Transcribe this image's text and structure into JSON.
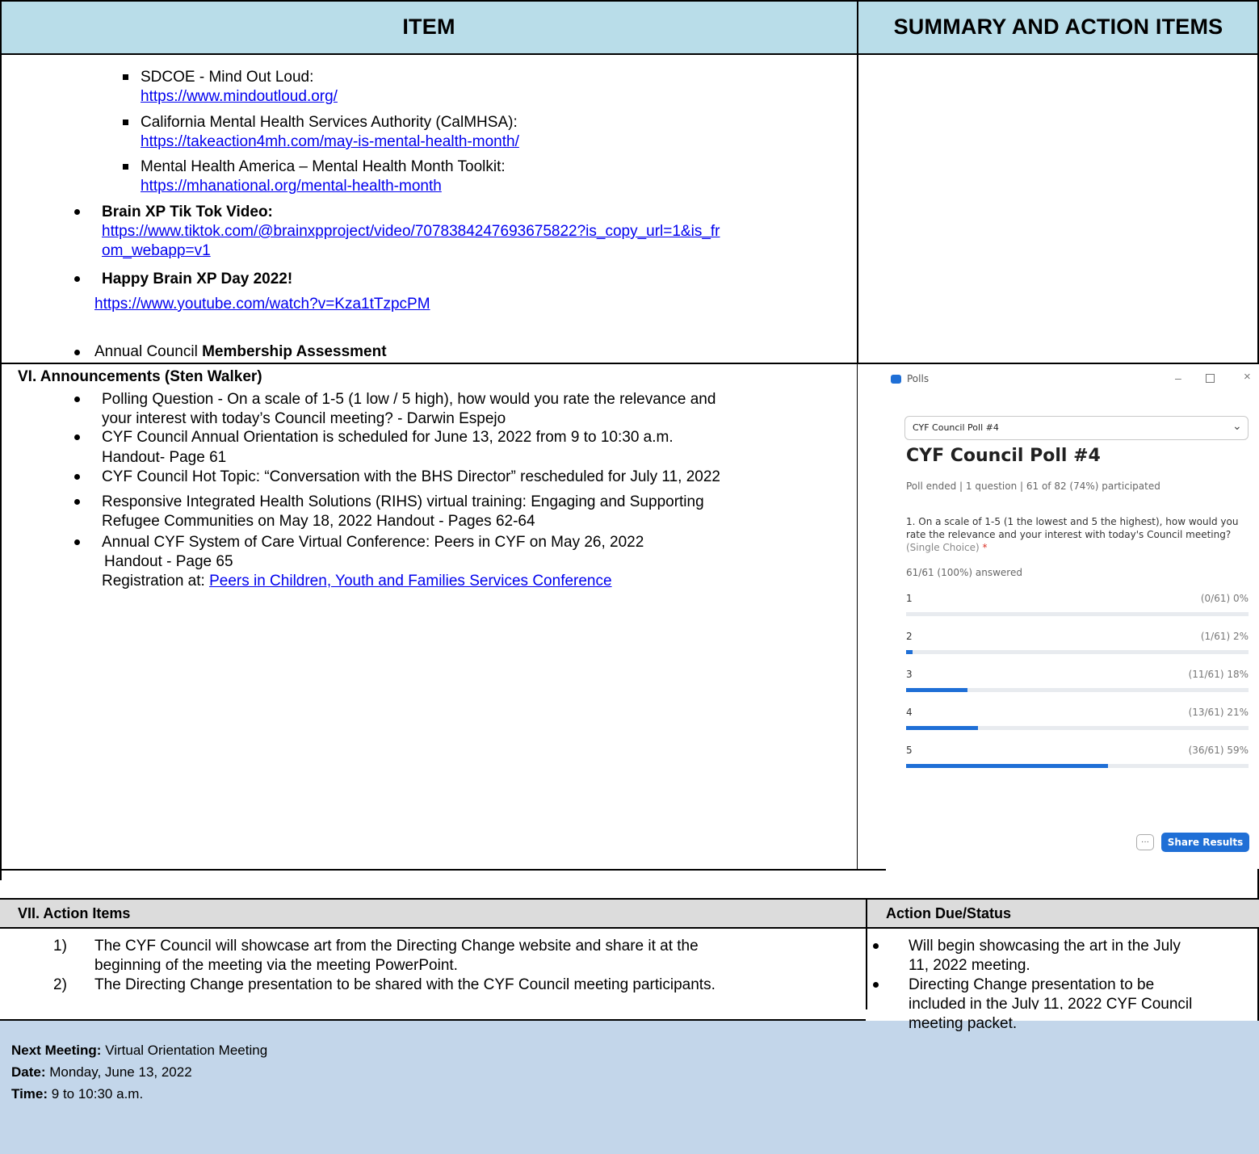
{
  "header": {
    "item": "ITEM",
    "summary": "SUMMARY AND ACTION ITEMS"
  },
  "resources": {
    "items": [
      {
        "label": "SDCOE - Mind Out Loud:",
        "url": "https://www.mindoutloud.org/"
      },
      {
        "label": "California Mental Health Services Authority (CalMHSA):",
        "url": "https://takeaction4mh.com/may-is-mental-health-month/"
      },
      {
        "label": "Mental Health America – Mental Health Month Toolkit:",
        "url": "https://mhanational.org/mental-health-month"
      }
    ],
    "tiktok_label": "Brain XP Tik Tok Video:",
    "tiktok_url_line1": "https://www.tiktok.com/@brainxpproject/video/7078384247693675822?is_copy_url=1&is_fr",
    "tiktok_url_line2": "om_webapp=v1",
    "brainxp_label": "Happy Brain XP Day 2022!",
    "brainxp_url": "https://www.youtube.com/watch?v=Kza1tTzpcPM",
    "assessment_prefix": "Annual Council ",
    "assessment_bold": "Membership Assessment"
  },
  "announcements": {
    "heading": "VI.  Announcements (Sten Walker)",
    "lines": [
      "Polling Question -  On a scale of 1-5 (1 low / 5 high), how would you rate the relevance and",
      "your interest with today’s Council meeting? - Darwin Espejo",
      "CYF Council Annual Orientation is scheduled for June 13, 2022 from 9 to 10:30 a.m.",
      "Handout- Page 61",
      "CYF Council Hot Topic: “Conversation with the BHS Director” rescheduled for July 11, 2022",
      "Responsive Integrated Health Solutions (RIHS) virtual training: Engaging and Supporting",
      "Refugee Communities on May 18, 2022 Handout - Pages 62-64",
      "Annual CYF System of Care Virtual Conference: Peers in CYF on May 26, 2022",
      "Handout - Page 65",
      "Registration at:  "
    ],
    "registration_link": "Peers in Children, Youth and Families Services Conference"
  },
  "poll": {
    "window_title": "Polls",
    "dropdown_value": "CYF Council Poll #4",
    "title": "CYF Council Poll #4",
    "meta": "Poll ended  |  1 question  |  61 of 82 (74%) participated",
    "question_line1": "1. On a scale of 1-5 (1 the lowest and 5 the highest), how would you",
    "question_line2": "rate the relevance and your interest with today's Council meeting?",
    "question_line3": "(Single Choice) ",
    "required_mark": "*",
    "answered": "61/61 (100%) answered",
    "options": [
      {
        "label": "1",
        "count_text": "(0/61) 0%",
        "fraction": 0.0
      },
      {
        "label": "2",
        "count_text": "(1/61) 2%",
        "fraction": 0.02
      },
      {
        "label": "3",
        "count_text": "(11/61) 18%",
        "fraction": 0.18
      },
      {
        "label": "4",
        "count_text": "(13/61) 21%",
        "fraction": 0.21
      },
      {
        "label": "5",
        "count_text": "(36/61) 59%",
        "fraction": 0.59
      }
    ],
    "more_label": "···",
    "share_button": "Share Results",
    "accent_color": "#1f6fd6"
  },
  "action_items": {
    "heading": "VII.  Action Items",
    "status_heading": "Action Due/Status",
    "items": [
      {
        "num": "1)",
        "line1": "The CYF Council will showcase art from the Directing Change website and share it at the",
        "line2": "beginning of the meeting via the meeting PowerPoint."
      },
      {
        "num": "2)",
        "line1": "The Directing Change presentation to be shared with the CYF Council meeting participants.",
        "line2": ""
      }
    ],
    "status": [
      {
        "line1": "Will begin showcasing the art in the July",
        "line2": "11, 2022 meeting.",
        "line3": ""
      },
      {
        "line1": "Directing Change presentation to be",
        "line2": "included in the July 11, 2022 CYF Council",
        "line3": "meeting packet."
      }
    ]
  },
  "next_meeting": {
    "label": "Next Meeting:",
    "value": " Virtual Orientation Meeting",
    "date_label": "Date:",
    "date_value": "  Monday, June 13, 2022",
    "time_label": "Time:",
    "time_value": " 9 to 10:30 a.m."
  }
}
